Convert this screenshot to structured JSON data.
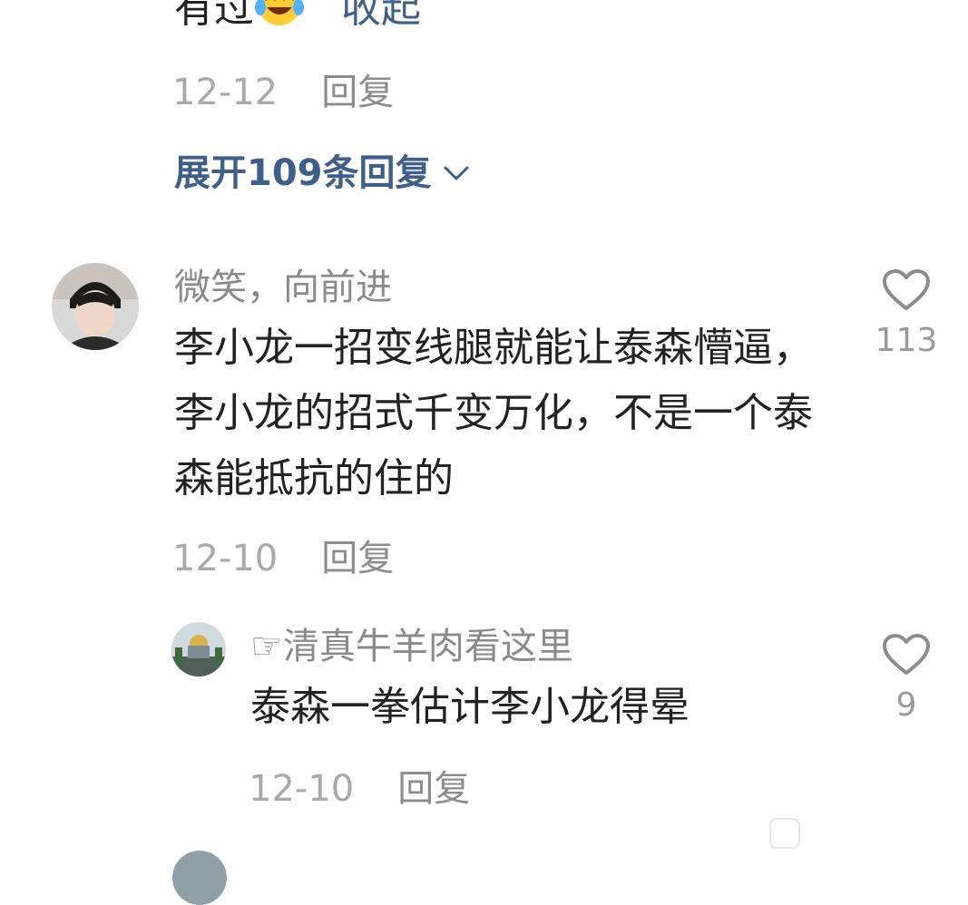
{
  "top_comment": {
    "text_tail": "有过",
    "emoji": "laughing-crying-emoji",
    "collapse_label": "收起",
    "date": "12-12",
    "reply_label": "回复"
  },
  "expand": {
    "label": "展开109条回复",
    "icon": "chevron-down-icon"
  },
  "comment": {
    "username": "微笑，向前进",
    "text": "李小龙一招变线腿就能让泰森懵逼，李小龙的招式千变万化，不是一个泰森能抵抗的住的",
    "date": "12-10",
    "reply_label": "回复",
    "likes": "113"
  },
  "reply": {
    "username_icon": "pointing-hand-icon",
    "username": "☞清真牛羊肉看这里",
    "text": "泰森一拳估计李小龙得晕",
    "date": "12-10",
    "reply_label": "回复",
    "likes": "9"
  },
  "colors": {
    "link": "#3e5f8a",
    "text": "#222222",
    "muted": "#a9a9a9"
  }
}
